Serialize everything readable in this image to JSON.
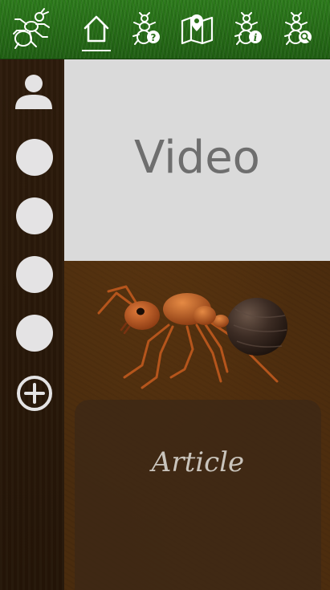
{
  "top_nav": {
    "items": [
      {
        "icon": "ant-logo-icon"
      },
      {
        "icon": "home-icon",
        "selected": true
      },
      {
        "icon": "bug-question-icon"
      },
      {
        "icon": "map-pin-icon"
      },
      {
        "icon": "bug-info-icon"
      },
      {
        "icon": "bug-search-icon"
      }
    ]
  },
  "sidebar": {
    "profile_icon": "user-icon",
    "add_icon": "add-circle-icon"
  },
  "main": {
    "video_label": "Video",
    "article_label": "Article",
    "illustration_icon": "ant-illustration"
  },
  "colors": {
    "top_bar": "#2c7a1b",
    "sidebar": "#2d1b0b",
    "content_bg": "#4a2c0e",
    "placeholder": "#dadada",
    "circle": "#e4e3e4"
  }
}
